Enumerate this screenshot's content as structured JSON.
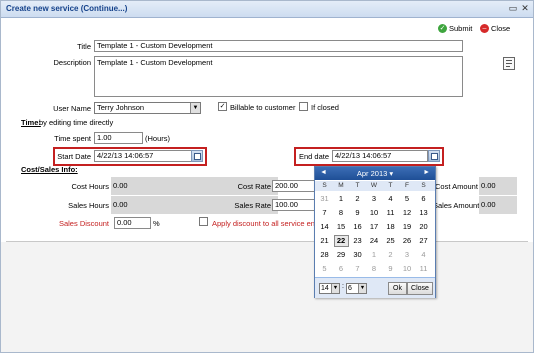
{
  "window": {
    "title": "Create new service (Continue...)"
  },
  "toolbar": {
    "submit_label": "Submit",
    "close_label": "Close"
  },
  "form": {
    "title_label": "Title",
    "title_value": "Template 1 - Custom Development",
    "description_label": "Description",
    "description_value": "Template 1 - Custom Development",
    "user_name_label": "User Name",
    "user_name_value": "Terry Johnson",
    "billable_label": "Billable to customer",
    "billable_check": "✓",
    "if_closed_label": "If closed",
    "time_heading": "Time:",
    "time_subheading": "by editing time directly",
    "time_spent_label": "Time spent",
    "time_spent_value": "1.00",
    "time_spent_unit": "(Hours)",
    "start_date_label": "Start Date",
    "start_date_value": "4/22/13 14:06:57",
    "end_date_label": "End date",
    "end_date_value": "4/22/13 14:06:57",
    "cost_sales_heading": "Cost/Sales Info:",
    "cost_hours_label": "Cost Hours",
    "cost_hours_value": "0.00",
    "sales_hours_label": "Sales Hours",
    "sales_hours_value": "0.00",
    "cost_rate_label": "Cost Rate",
    "cost_rate_value": "200.00",
    "sales_rate_label": "Sales Rate",
    "sales_rate_value": "100.00",
    "cost_amount_label": "Cost Amount",
    "cost_amount_value": "0.00",
    "sales_amount_label": "Sales Amount",
    "sales_amount_value": "0.00",
    "sales_discount_label": "Sales Discount",
    "sales_discount_value": "0.00",
    "sales_discount_unit": "%",
    "apply_discount_label": "Apply discount to all service ent"
  },
  "calendar": {
    "month_label": "Apr 2013",
    "prev": "◄",
    "next": "►",
    "month_arrow": "▾",
    "dow": [
      "S",
      "M",
      "T",
      "W",
      "T",
      "F",
      "S"
    ],
    "weeks": [
      [
        {
          "d": "31",
          "o": true
        },
        {
          "d": "1"
        },
        {
          "d": "2"
        },
        {
          "d": "3"
        },
        {
          "d": "4"
        },
        {
          "d": "5"
        },
        {
          "d": "6"
        }
      ],
      [
        {
          "d": "7"
        },
        {
          "d": "8"
        },
        {
          "d": "9"
        },
        {
          "d": "10"
        },
        {
          "d": "11"
        },
        {
          "d": "12"
        },
        {
          "d": "13"
        }
      ],
      [
        {
          "d": "14"
        },
        {
          "d": "15"
        },
        {
          "d": "16"
        },
        {
          "d": "17"
        },
        {
          "d": "18"
        },
        {
          "d": "19"
        },
        {
          "d": "20"
        }
      ],
      [
        {
          "d": "21"
        },
        {
          "d": "22",
          "s": true
        },
        {
          "d": "23"
        },
        {
          "d": "24"
        },
        {
          "d": "25"
        },
        {
          "d": "26"
        },
        {
          "d": "27"
        }
      ],
      [
        {
          "d": "28"
        },
        {
          "d": "29"
        },
        {
          "d": "30"
        },
        {
          "d": "1",
          "o": true
        },
        {
          "d": "2",
          "o": true
        },
        {
          "d": "3",
          "o": true
        },
        {
          "d": "4",
          "o": true
        }
      ],
      [
        {
          "d": "5",
          "o": true
        },
        {
          "d": "6",
          "o": true
        },
        {
          "d": "7",
          "o": true
        },
        {
          "d": "8",
          "o": true
        },
        {
          "d": "9",
          "o": true
        },
        {
          "d": "10",
          "o": true
        },
        {
          "d": "11",
          "o": true
        }
      ]
    ],
    "hour_value": "14",
    "minute_value": "6",
    "ok_label": "Ok",
    "close_label": "Close"
  },
  "colors": {
    "red_label": "#c42020",
    "title_blue": "#15428b",
    "calendar_header": "#2a5ca8"
  }
}
